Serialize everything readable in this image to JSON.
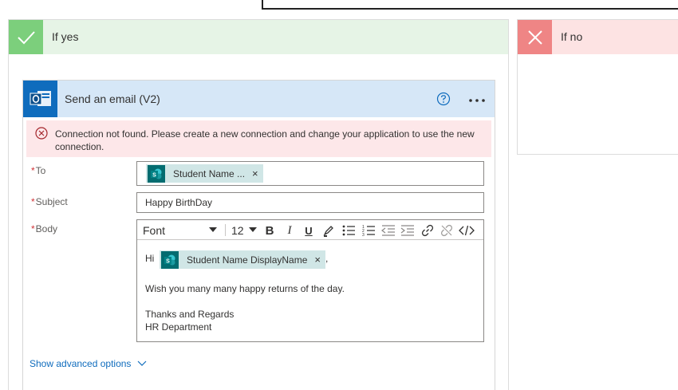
{
  "yes_branch": {
    "title": "If yes"
  },
  "no_branch": {
    "title": "If no"
  },
  "action": {
    "title": "Send an email (V2)",
    "error_message": "Connection not found. Please create a new connection and change your application to use the new connection.",
    "fields": {
      "to": {
        "label": "To",
        "required_mark": "*",
        "token": "Student Name ..."
      },
      "subject": {
        "label": "Subject",
        "required_mark": "*",
        "value": "Happy BirthDay"
      },
      "body": {
        "label": "Body",
        "required_mark": "*",
        "toolbar": {
          "font": "Font",
          "size": "12",
          "bold": "B",
          "italic": "I",
          "underline": "U"
        },
        "greeting": "Hi",
        "token": "Student Name DisplayName",
        "after_token": ",",
        "line1": "Wish you many many happy returns of the day.",
        "line2": "Thanks and Regards",
        "line3": "HR Department"
      }
    },
    "advanced_label": "Show advanced options",
    "token_close": "×"
  },
  "colors": {
    "yes_accent": "#7ccf7c",
    "no_accent": "#ef8585",
    "outlook_blue": "#0f6cbd",
    "sharepoint_teal": "#036c70",
    "error_red": "#a4262c"
  }
}
